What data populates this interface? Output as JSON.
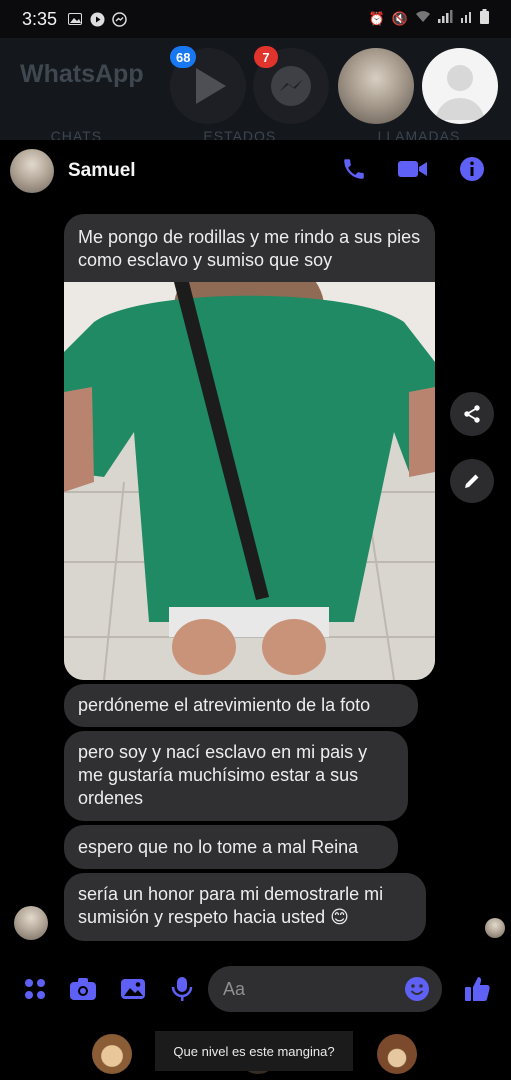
{
  "status_bar": {
    "time": "3:35"
  },
  "background_app": {
    "title": "WhatsApp",
    "tabs": [
      "CHATS",
      "ESTADOS",
      "LLAMADAS"
    ],
    "bubble_heads": [
      {
        "icon": "play-video-icon",
        "badge": "68"
      },
      {
        "icon": "messenger-icon",
        "badge": "7"
      },
      {
        "icon": "contact-photo"
      },
      {
        "icon": "blank-profile-icon"
      }
    ]
  },
  "chat_header": {
    "contact_name": "Samuel",
    "actions": [
      "phone-icon",
      "video-call-icon",
      "info-icon"
    ]
  },
  "messages": [
    {
      "text": "Me pongo de rodillas y me rindo a sus pies como esclavo y sumiso que soy"
    },
    {
      "type": "photo",
      "icon": "attached-photo"
    },
    {
      "text": "perdóneme el atrevimiento de la foto"
    },
    {
      "text": "pero soy y nací esclavo en mi pais y me gustaría muchísimo estar a sus ordenes"
    },
    {
      "text": "espero que no lo tome a mal Reina"
    },
    {
      "text": "sería un honor para mi demostrarle mi sumisión y respeto hacia usted 😊"
    }
  ],
  "composer": {
    "placeholder": "Aa",
    "icons": [
      "apps-grid-icon",
      "camera-icon",
      "gallery-icon",
      "microphone-icon",
      "emoji-icon",
      "thumbs-up-icon"
    ]
  },
  "caption": {
    "text": "Que nivel es este mangina?"
  },
  "colors": {
    "accent": "#5f61f6",
    "bubble": "#303033",
    "background": "#000000"
  }
}
